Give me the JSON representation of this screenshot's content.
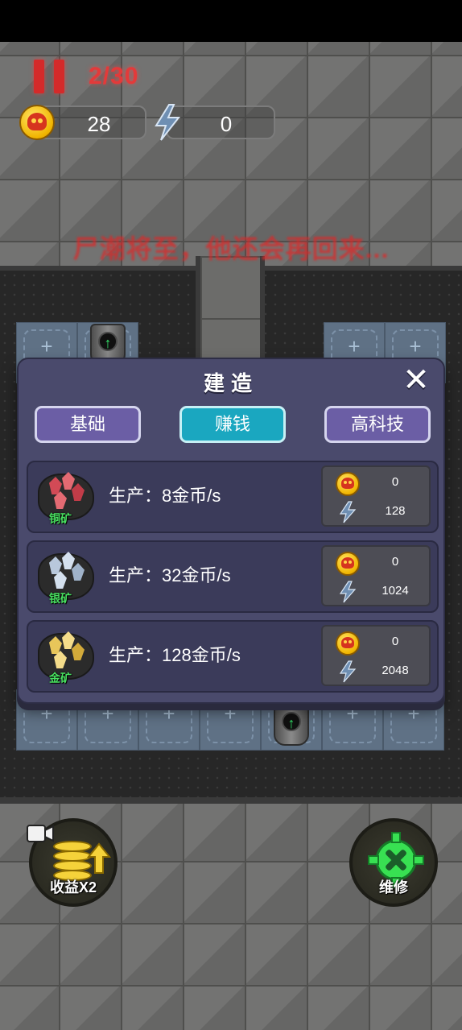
{
  "hud": {
    "wave": "2/30",
    "coins": "28",
    "energy": "0"
  },
  "warning": "尸潮将至，他还会再回来...",
  "build_modal": {
    "title": "建造",
    "tabs": [
      {
        "label": "基础",
        "active": false
      },
      {
        "label": "赚钱",
        "active": true
      },
      {
        "label": "高科技",
        "active": false
      }
    ],
    "items": [
      {
        "ore": "铜矿",
        "production": "生产：8金币/s",
        "coin_cost": "0",
        "energy_cost": "128",
        "gem_color": "#d24a56"
      },
      {
        "ore": "银矿",
        "production": "生产：32金币/s",
        "coin_cost": "0",
        "energy_cost": "1024",
        "gem_color": "#b8c8dc"
      },
      {
        "ore": "金矿",
        "production": "生产：128金币/s",
        "coin_cost": "0",
        "energy_cost": "2048",
        "gem_color": "#e8c65a"
      }
    ]
  },
  "buttons": {
    "income_x2": "收益X2",
    "repair": "维修"
  },
  "colors": {
    "accent_red": "#e33a3a",
    "active_tab": "#1aa7c0",
    "repair_green": "#38e052",
    "coin_gold": "#f0b400"
  },
  "icons": {
    "pause": "pause-icon",
    "coin": "skull-coin-icon",
    "energy": "lightning-bolt-icon",
    "close": "close-x-icon",
    "video": "video-camera-icon",
    "repair": "wrench-gear-icon"
  }
}
